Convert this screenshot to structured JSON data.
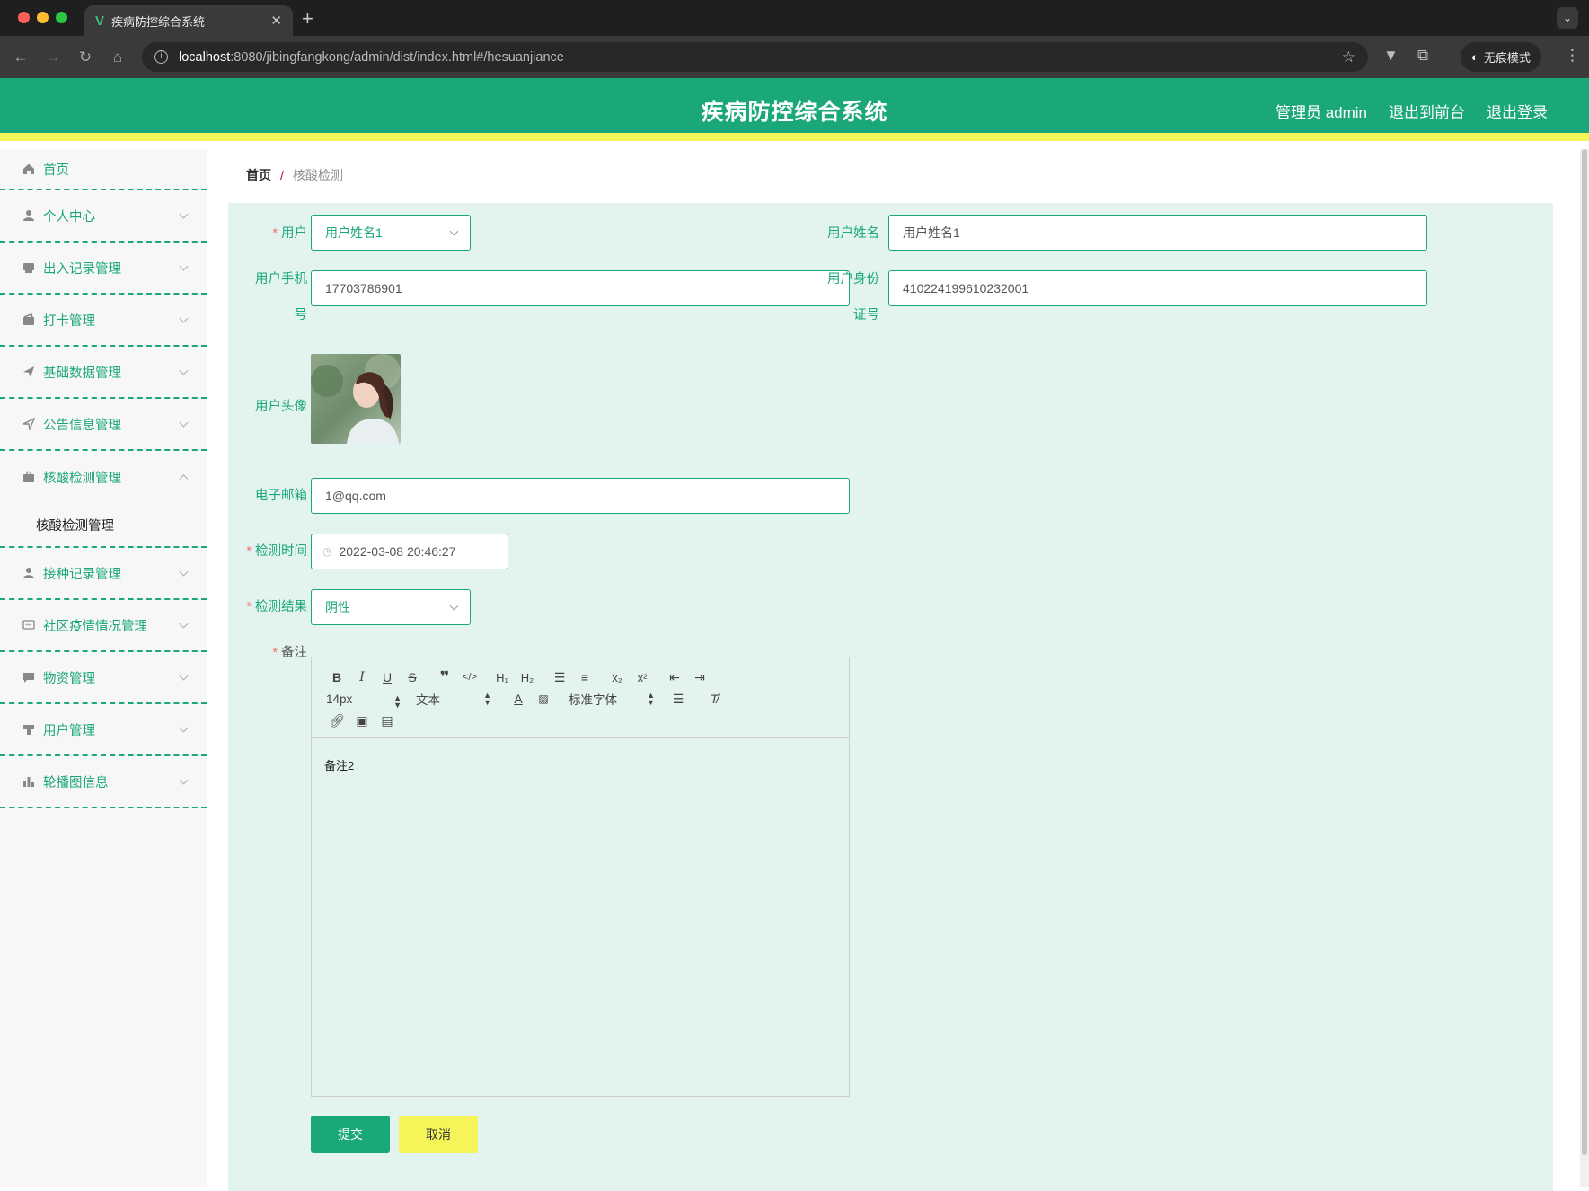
{
  "browser": {
    "tab_title": "疾病防控综合系统",
    "url_host": "localhost",
    "url_rest": ":8080/jibingfangkong/admin/dist/index.html#/hesuanjiance",
    "incognito_label": "无痕模式"
  },
  "header": {
    "title": "疾病防控综合系统",
    "user_label": "管理员 admin",
    "to_front_label": "退出到前台",
    "logout_label": "退出登录"
  },
  "sidebar": {
    "items": [
      {
        "label": "首页",
        "icon": "home-icon"
      },
      {
        "label": "个人中心",
        "icon": "user-icon"
      },
      {
        "label": "出入记录管理",
        "icon": "printer-icon"
      },
      {
        "label": "打卡管理",
        "icon": "wallet-icon"
      },
      {
        "label": "基础数据管理",
        "icon": "paper-plane-icon"
      },
      {
        "label": "公告信息管理",
        "icon": "location-icon"
      },
      {
        "label": "核酸检测管理",
        "icon": "briefcase-icon"
      },
      {
        "label": "接种记录管理",
        "icon": "user-icon"
      },
      {
        "label": "社区疫情情况管理",
        "icon": "chat-icon"
      },
      {
        "label": "物资管理",
        "icon": "message-icon"
      },
      {
        "label": "用户管理",
        "icon": "stamp-icon"
      },
      {
        "label": "轮播图信息",
        "icon": "bar-chart-icon"
      }
    ],
    "submenu_label": "核酸检测管理"
  },
  "breadcrumb": {
    "home": "首页",
    "current": "核酸检测"
  },
  "form": {
    "user_label": "用户",
    "user_value": "用户姓名1",
    "username_label": "用户姓名",
    "username_value": "用户姓名1",
    "phone_label_1": "用户手机",
    "phone_label_2": "号",
    "phone_value": "17703786901",
    "idcard_label_1": "用户身份",
    "idcard_label_2": "证号",
    "idcard_value": "410224199610232001",
    "avatar_label": "用户头像",
    "email_label": "电子邮箱",
    "email_value": "1@qq.com",
    "time_label": "检测时间",
    "time_value": "2022-03-08 20:46:27",
    "result_label": "检测结果",
    "result_value": "阴性",
    "remark_label": "备注",
    "remark_value": "备注2",
    "editor": {
      "font_size": "14px",
      "block_type": "文本",
      "font_family": "标准字体"
    },
    "submit_label": "提交",
    "cancel_label": "取消"
  },
  "colors": {
    "primary": "#1aa77a",
    "accent_yellow": "#f5f55a",
    "panel_bg": "#e3f3ef",
    "required": "#f56c6c"
  }
}
